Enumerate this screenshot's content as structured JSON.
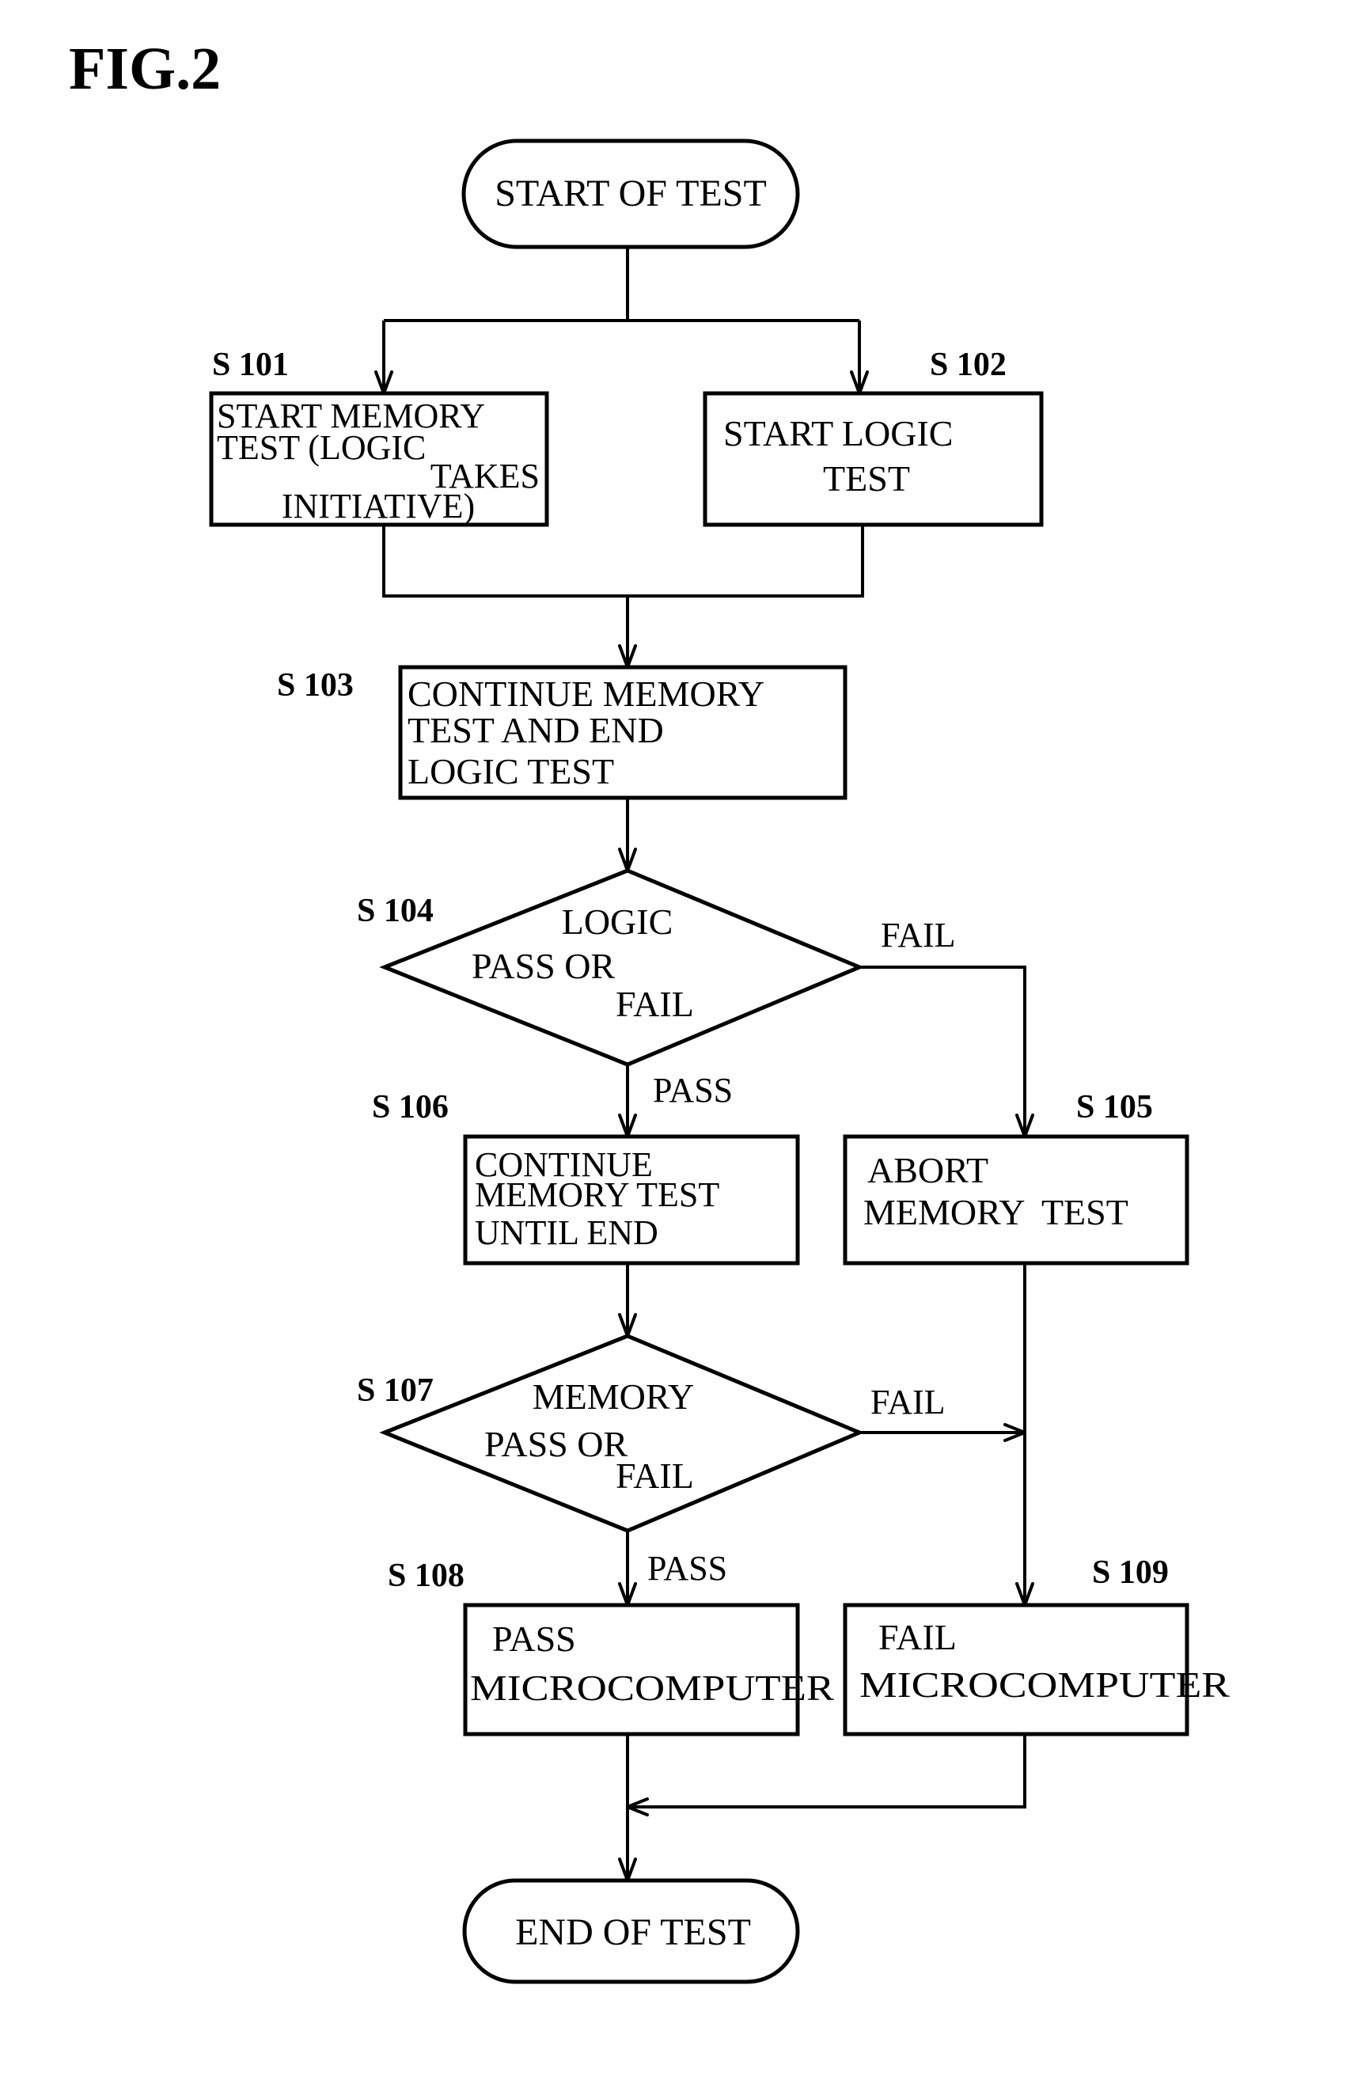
{
  "figure": {
    "title": "FIG.2"
  },
  "terminals": {
    "start": "START OF TEST",
    "end": "END OF TEST"
  },
  "steps": {
    "s101": {
      "id": "S 101",
      "lines": [
        "START MEMORY",
        "TEST (LOGIC",
        "TAKES",
        "INITIATIVE)"
      ]
    },
    "s102": {
      "id": "S 102",
      "lines": [
        "START LOGIC",
        "TEST"
      ]
    },
    "s103": {
      "id": "S 103",
      "lines": [
        "CONTINUE MEMORY",
        "TEST AND END",
        "LOGIC TEST"
      ]
    },
    "s104": {
      "id": "S 104",
      "lines": [
        "LOGIC",
        "PASS OR",
        "FAIL"
      ]
    },
    "s105": {
      "id": "S 105",
      "lines": [
        "ABORT",
        "MEMORY  TEST"
      ]
    },
    "s106": {
      "id": "S 106",
      "lines": [
        "CONTINUE",
        "MEMORY  TEST",
        "UNTIL END"
      ]
    },
    "s107": {
      "id": "S 107",
      "lines": [
        "MEMORY",
        "PASS OR",
        "FAIL"
      ]
    },
    "s108": {
      "id": "S 108",
      "lines": [
        "PASS",
        "MICROCOMPUTER"
      ]
    },
    "s109": {
      "id": "S 109",
      "lines": [
        "FAIL",
        "MICROCOMPUTER"
      ]
    }
  },
  "edges": {
    "s104_fail": "FAIL",
    "s104_pass": "PASS",
    "s107_fail": "FAIL",
    "s107_pass": "PASS"
  }
}
